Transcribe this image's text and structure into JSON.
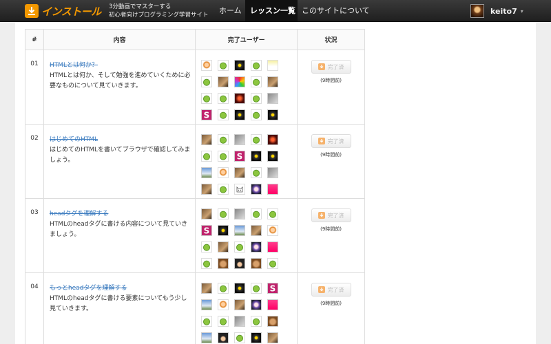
{
  "header": {
    "logo_text": "インストール",
    "tagline_line1": "3分動画でマスターする",
    "tagline_line2": "初心者向けプログラミング学習サイト",
    "nav": [
      {
        "label": "ホーム"
      },
      {
        "label": "レッスン一覧"
      },
      {
        "label": "このサイトについて"
      }
    ],
    "user": {
      "name": "keito7",
      "caret": "▾"
    }
  },
  "table": {
    "headers": {
      "num": "#",
      "content": "内容",
      "users": "完了ユーザー",
      "status": "状況"
    },
    "rows": [
      {
        "num": "01",
        "title": "HTMLとは何か？",
        "description": "HTMLとは何か、そして勉強を進めていくために必要なものについて見ていきます。",
        "status_label": "完了済",
        "time_ago": "(9時間前)",
        "avatars": [
          "girl",
          "leaf",
          "dark",
          "leaf",
          "fox",
          "leaf",
          "photo",
          "color",
          "leaf",
          "photo",
          "leaf",
          "leaf",
          "red",
          "leaf",
          "gray",
          "s",
          "leaf",
          "dark",
          "leaf",
          "dark"
        ]
      },
      {
        "num": "02",
        "title": "はじめてのHTML",
        "description": "はじめてのHTMLを書いてブラウザで確認してみましょう。",
        "status_label": "完了済",
        "time_ago": "(9時間前)",
        "avatars": [
          "photo",
          "leaf",
          "gray",
          "leaf",
          "red",
          "leaf",
          "leaf",
          "s",
          "dark",
          "dark",
          "sky",
          "girl",
          "photo",
          "leaf",
          "gray",
          "photo",
          "leaf",
          "cat",
          "blue",
          "pink"
        ]
      },
      {
        "num": "03",
        "title": "headタグを理解する",
        "description": "HTMLのheadタグに書ける内容について見ていきましょう。",
        "status_label": "完了済",
        "time_ago": "(9時間前)",
        "avatars": [
          "photo",
          "leaf",
          "gray",
          "leaf",
          "leaf",
          "s",
          "dark",
          "sky",
          "photo",
          "girl",
          "leaf",
          "photo",
          "leaf",
          "blue",
          "pink",
          "leaf",
          "dog",
          "anime",
          "dog",
          "leaf"
        ]
      },
      {
        "num": "04",
        "title": "もっとheadタグを理解する",
        "description": "HTMLのheadタグに書ける要素についてもう少し見ていきます。",
        "status_label": "完了済",
        "time_ago": "(9時間前)",
        "avatars": [
          "photo",
          "leaf",
          "dark",
          "leaf",
          "s",
          "sky",
          "girl",
          "photo",
          "blue",
          "pink",
          "leaf",
          "leaf",
          "gray",
          "leaf",
          "dog",
          "sky",
          "anime",
          "leaf",
          "dark",
          "photo"
        ]
      }
    ]
  },
  "colors": {
    "accent": "#f39800",
    "link": "#3b7bbf",
    "header_bg": "#262626"
  }
}
